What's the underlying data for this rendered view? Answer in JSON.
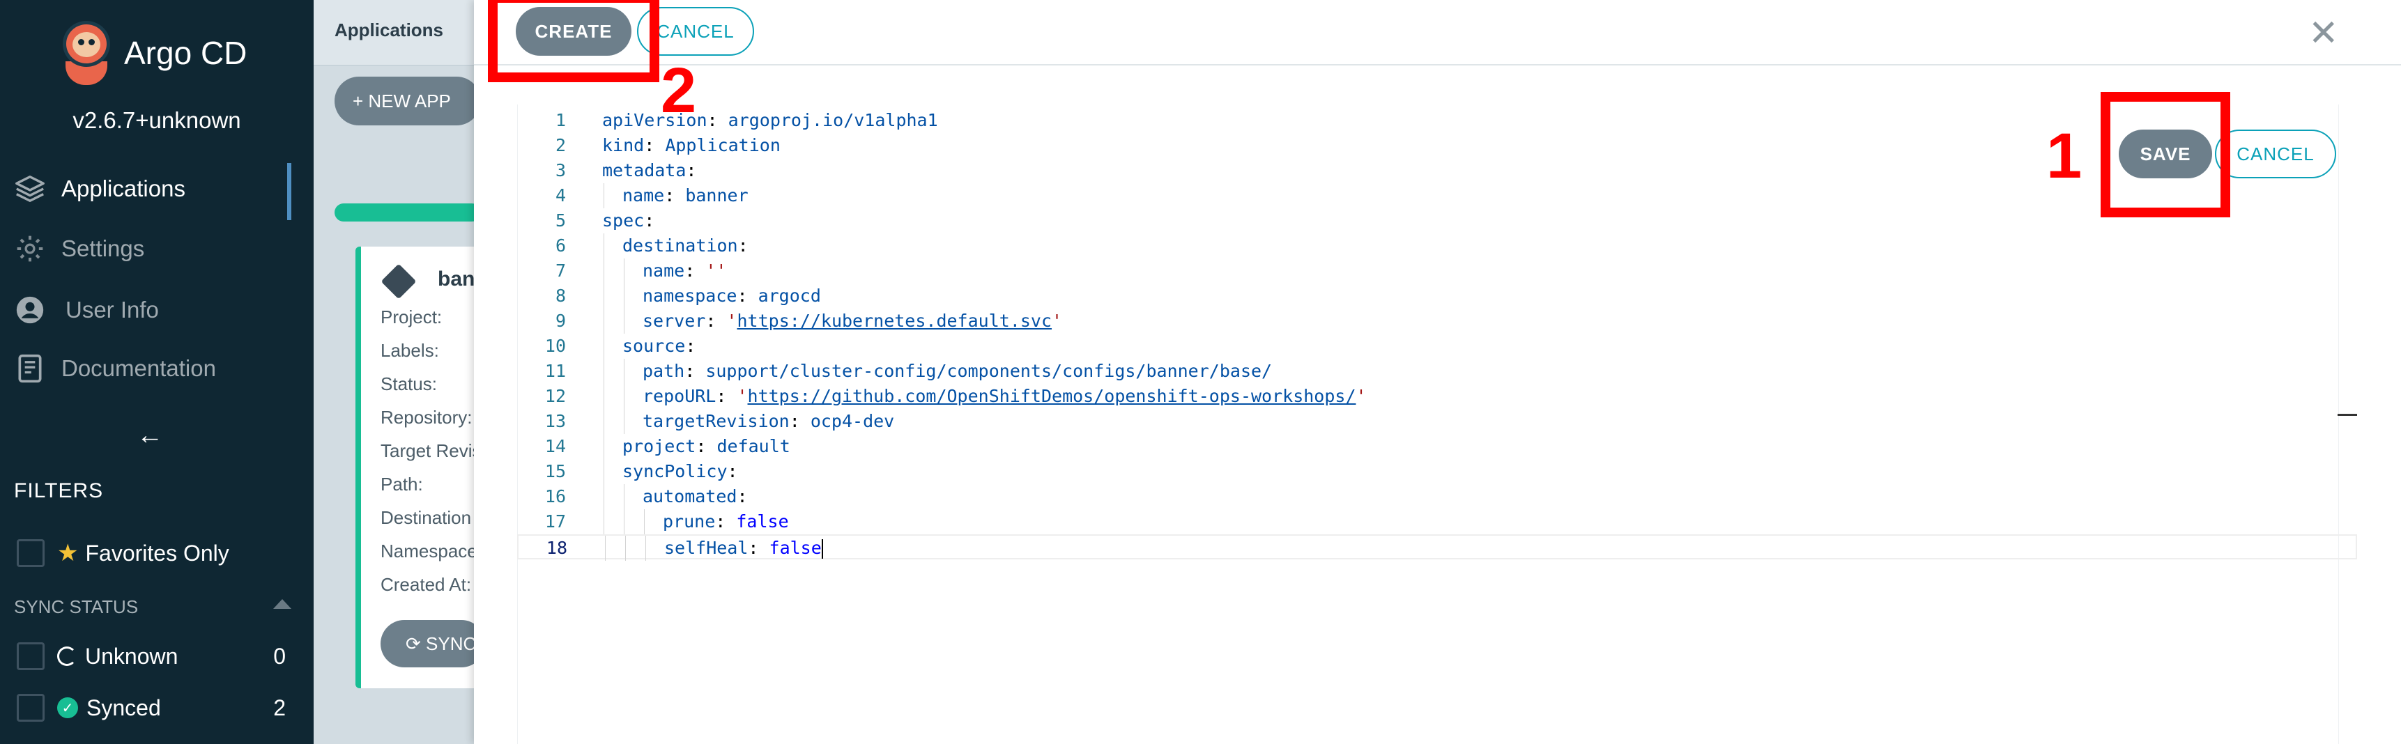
{
  "sidebar": {
    "brand": "Argo CD",
    "version": "v2.6.7+unknown",
    "nav": [
      {
        "label": "Applications",
        "icon": "layers-icon"
      },
      {
        "label": "Settings",
        "icon": "gear-icon"
      },
      {
        "label": "User Info",
        "icon": "user-icon"
      },
      {
        "label": "Documentation",
        "icon": "book-icon"
      }
    ],
    "collapse_icon": "←",
    "filters_title": "FILTERS",
    "favorites_label": "Favorites Only",
    "sync_status_title": "SYNC STATUS",
    "sync_filters": [
      {
        "label": "Unknown",
        "count": "0"
      },
      {
        "label": "Synced",
        "count": "2"
      }
    ]
  },
  "page": {
    "title": "Applications",
    "new_app_label": "+ NEW APP",
    "app_name": "ban",
    "card_labels": [
      "Project:",
      "Labels:",
      "Status:",
      "Repository:",
      "Target Revis",
      "Path:",
      "Destination",
      "Namespace",
      "Created At:"
    ],
    "sync_label": "⟳ SYNC"
  },
  "panel": {
    "create_label": "CREATE",
    "cancel_top_label": "CANCEL",
    "save_label": "SAVE",
    "cancel_label": "CANCEL",
    "close_icon": "✕"
  },
  "editor": {
    "lines": [
      {
        "n": "1",
        "indent": 0,
        "key": "apiVersion",
        "val": "argoproj.io/v1alpha1",
        "vtype": "v"
      },
      {
        "n": "2",
        "indent": 0,
        "key": "kind",
        "val": "Application",
        "vtype": "v"
      },
      {
        "n": "3",
        "indent": 0,
        "key": "metadata",
        "val": "",
        "vtype": ""
      },
      {
        "n": "4",
        "indent": 1,
        "key": "name",
        "val": "banner",
        "vtype": "v"
      },
      {
        "n": "5",
        "indent": 0,
        "key": "spec",
        "val": "",
        "vtype": ""
      },
      {
        "n": "6",
        "indent": 1,
        "key": "destination",
        "val": "",
        "vtype": ""
      },
      {
        "n": "7",
        "indent": 2,
        "key": "name",
        "val": "''",
        "vtype": "s"
      },
      {
        "n": "8",
        "indent": 2,
        "key": "namespace",
        "val": "argocd",
        "vtype": "v"
      },
      {
        "n": "9",
        "indent": 2,
        "key": "server",
        "val": "'https://kubernetes.default.svc'",
        "vtype": "url"
      },
      {
        "n": "10",
        "indent": 1,
        "key": "source",
        "val": "",
        "vtype": ""
      },
      {
        "n": "11",
        "indent": 2,
        "key": "path",
        "val": "support/cluster-config/components/configs/banner/base/",
        "vtype": "v"
      },
      {
        "n": "12",
        "indent": 2,
        "key": "repoURL",
        "val": "'https://github.com/OpenShiftDemos/openshift-ops-workshops/'",
        "vtype": "url"
      },
      {
        "n": "13",
        "indent": 2,
        "key": "targetRevision",
        "val": "ocp4-dev",
        "vtype": "v"
      },
      {
        "n": "14",
        "indent": 1,
        "key": "project",
        "val": "default",
        "vtype": "v"
      },
      {
        "n": "15",
        "indent": 1,
        "key": "syncPolicy",
        "val": "",
        "vtype": ""
      },
      {
        "n": "16",
        "indent": 2,
        "key": "automated",
        "val": "",
        "vtype": ""
      },
      {
        "n": "17",
        "indent": 3,
        "key": "prune",
        "val": "false",
        "vtype": "b"
      },
      {
        "n": "18",
        "indent": 3,
        "key": "selfHeal",
        "val": "false",
        "vtype": "b"
      }
    ]
  },
  "annotations": {
    "label_1": "1",
    "label_2": "2",
    "color": "#ff0000"
  },
  "colors": {
    "sidebar_bg": "#0f2733",
    "accent": "#0ba1b8",
    "button_gray": "#6d7f8b",
    "healthy_green": "#18be94"
  }
}
